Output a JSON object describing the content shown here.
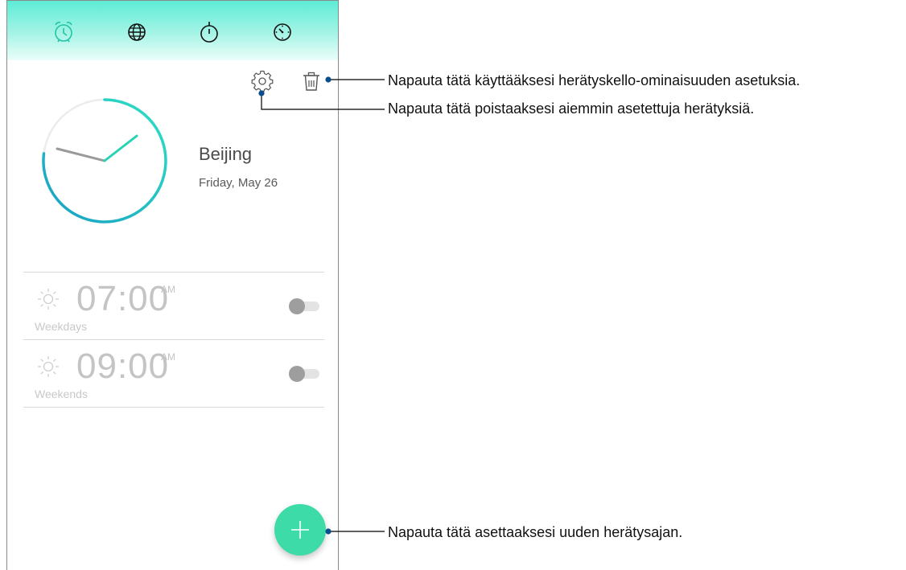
{
  "tabs": [
    {
      "name": "alarm",
      "icon": "alarm-clock-icon",
      "active": true
    },
    {
      "name": "world-clock",
      "icon": "globe-icon",
      "active": false
    },
    {
      "name": "stopwatch",
      "icon": "stopwatch-icon",
      "active": false
    },
    {
      "name": "timer",
      "icon": "timer-icon",
      "active": false
    }
  ],
  "toolbar": {
    "settings_icon": "gear-icon",
    "delete_icon": "trash-icon"
  },
  "clock": {
    "city": "Beijing",
    "date": "Friday, May 26"
  },
  "alarms": [
    {
      "time": "07:00",
      "ampm": "AM",
      "repeat": "Weekdays",
      "enabled": false
    },
    {
      "time": "09:00",
      "ampm": "AM",
      "repeat": "Weekends",
      "enabled": false
    }
  ],
  "fab": {
    "icon": "plus-icon"
  },
  "callouts": {
    "trash": "Napauta tätä käyttääksesi herätyskello-ominaisuuden asetuksia.",
    "settings": "Napauta tätä poistaaksesi aiemmin asetettuja herätyksiä.",
    "add": "Napauta tätä asettaaksesi uuden herätysajan."
  },
  "colors": {
    "accent": "#3ddba8",
    "active_tab": "#22c3a6",
    "clock_ring_start": "#2ee0c4",
    "clock_ring_end": "#1a9fc4"
  }
}
